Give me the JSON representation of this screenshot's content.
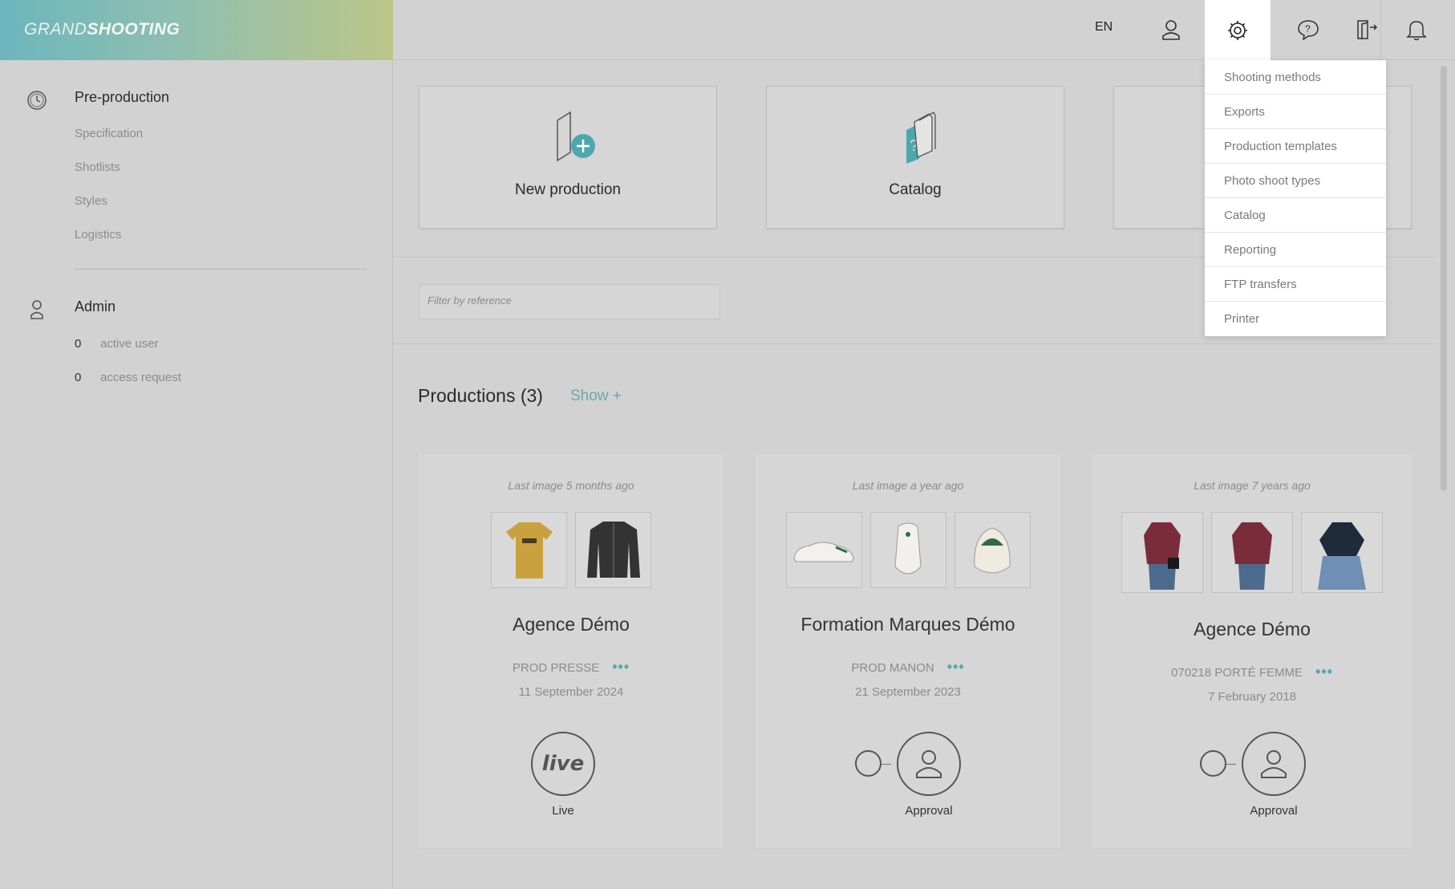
{
  "app": {
    "logo_light": "GRAND",
    "logo_bold": "SHOOTING"
  },
  "header": {
    "language": "EN",
    "icons": [
      "user-icon",
      "gear-icon",
      "help-icon",
      "logout-icon",
      "bell-icon"
    ]
  },
  "sidebar": {
    "preproduction": {
      "title": "Pre-production",
      "items": [
        "Specification",
        "Shotlists",
        "Styles",
        "Logistics"
      ]
    },
    "admin": {
      "title": "Admin",
      "active_user_count": "0",
      "active_user_label": "active user",
      "access_request_count": "0",
      "access_request_label": "access request"
    }
  },
  "tiles": {
    "new_production": "New production",
    "catalog": "Catalog"
  },
  "filter": {
    "placeholder": "Filter by reference"
  },
  "productions": {
    "title": "Productions (3)",
    "show_label": "Show +",
    "cards": [
      {
        "last_image": "Last image 5 months ago",
        "name": "Agence Démo",
        "ref": "PROD PRESSE",
        "date": "11 September 2024",
        "status": "Live",
        "status_icon_text": "live"
      },
      {
        "last_image": "Last image a year ago",
        "name": "Formation Marques Démo",
        "ref": "PROD MANON",
        "date": "21 September 2023",
        "status": "Approval"
      },
      {
        "last_image": "Last image 7 years ago",
        "name": "Agence Démo",
        "ref": "070218 PORTÉ FEMME",
        "date": "7 February 2018",
        "status": "Approval"
      }
    ],
    "more_dots": "•••"
  },
  "settings_menu": {
    "items": [
      "Shooting methods",
      "Exports",
      "Production templates",
      "Photo shoot types",
      "Catalog",
      "Reporting",
      "FTP transfers",
      "Printer"
    ]
  }
}
